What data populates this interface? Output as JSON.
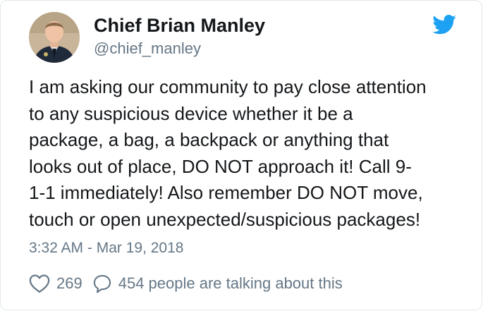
{
  "tweet": {
    "author": {
      "display_name": "Chief Brian Manley",
      "handle": "@chief_manley",
      "avatar_icon": "profile-photo-police-uniform"
    },
    "brand_icon": "twitter-bird-icon",
    "brand_color": "#1da1f2",
    "text_lines": [
      "I am asking our community to pay close attention",
      "to any suspicious device whether it be a",
      "package, a bag, a backpack or anything that",
      "looks out of place, DO NOT approach it! Call 9-",
      "1-1 immediately! Also remember DO NOT move,",
      "touch or open unexpected/suspicious packages!"
    ],
    "timestamp": "3:32 AM - Mar 19, 2018",
    "likes": "269",
    "talking_label": "454 people are talking about this"
  },
  "colors": {
    "text_primary": "#14171a",
    "text_secondary": "#657786",
    "border": "#e1e8ed"
  }
}
